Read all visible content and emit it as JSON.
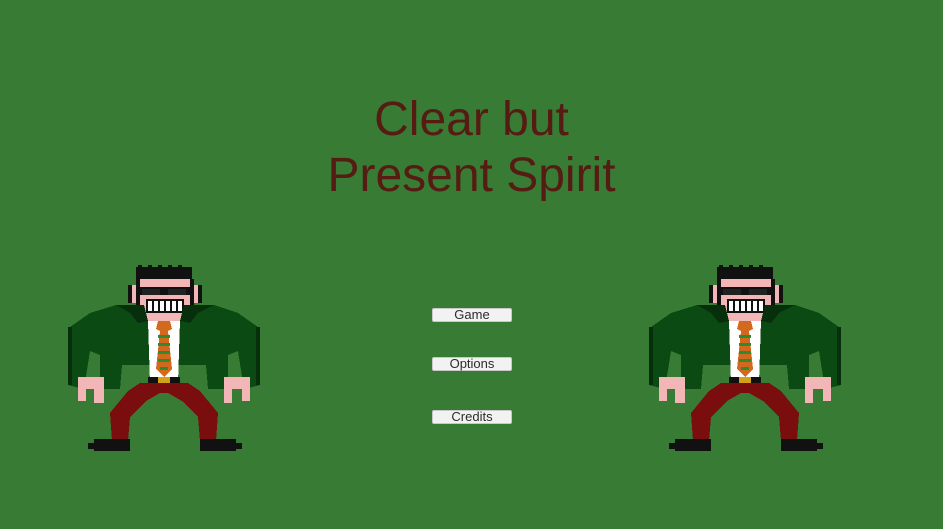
{
  "game": {
    "title_line1": "Clear but",
    "title_line2": "Present Spirit"
  },
  "menu": {
    "buttons": [
      {
        "label": "Game"
      },
      {
        "label": "Options"
      },
      {
        "label": "Credits"
      }
    ]
  },
  "colors": {
    "background": "#377b34",
    "title": "#561b12",
    "button_face": "#f2f2f2"
  },
  "characters": {
    "left": {
      "icon": "pixel-spirit-character"
    },
    "right": {
      "icon": "pixel-spirit-character"
    }
  }
}
